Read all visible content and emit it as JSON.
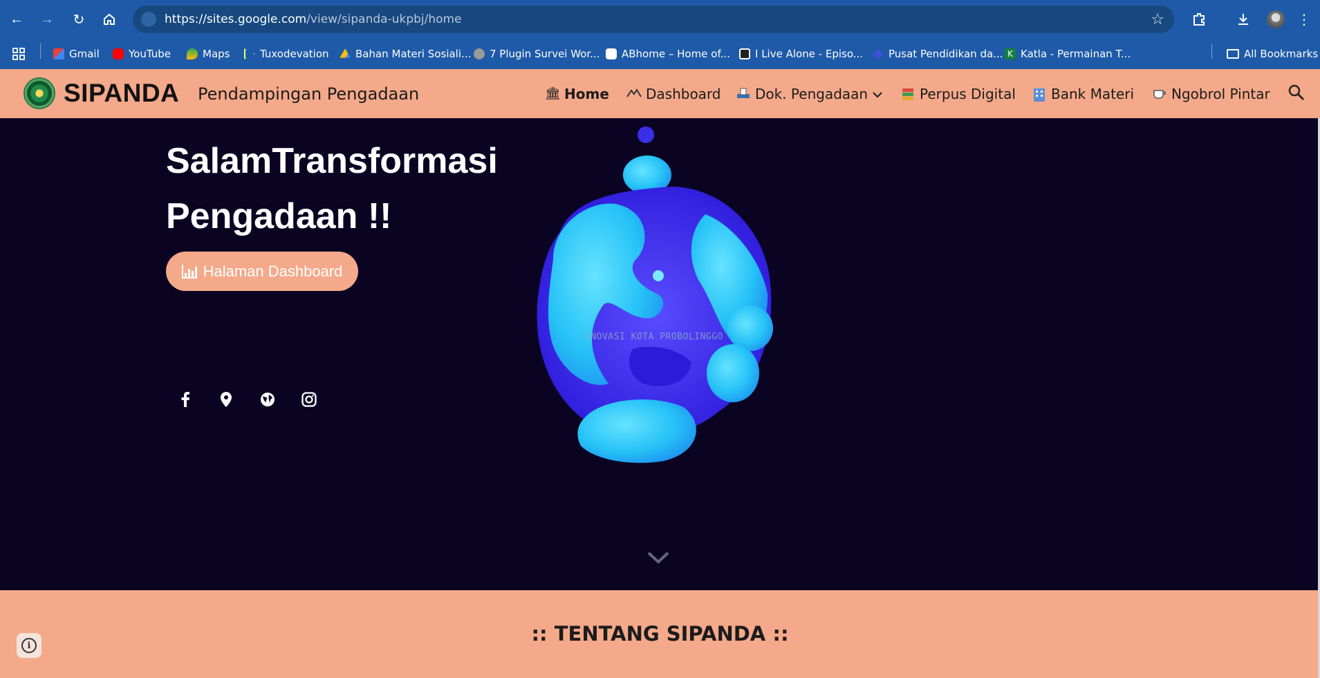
{
  "browser": {
    "url_domain": "https://sites.google.com",
    "url_path": "/view/sipanda-ukpbj/home",
    "nav_icons": [
      "back-icon",
      "forward-icon",
      "reload-icon",
      "home-icon"
    ],
    "right_icons": [
      "extensions-icon",
      "download-icon",
      "profile-avatar",
      "kebab-menu-icon"
    ],
    "colors": {
      "chrome": "#1e5aa8",
      "omnibox": "#17487f"
    }
  },
  "bookmarks": {
    "items": [
      {
        "label": "Gmail",
        "icon": "gmail-icon"
      },
      {
        "label": "YouTube",
        "icon": "youtube-icon"
      },
      {
        "label": "Maps",
        "icon": "maps-icon"
      },
      {
        "label": "Tuxodevation",
        "icon": "play-outline-icon"
      },
      {
        "label": "Bahan Materi Sosiali...",
        "icon": "google-drive-icon"
      },
      {
        "label": "7 Plugin Survei Wor...",
        "icon": "site-icon"
      },
      {
        "label": "ABhome – Home of...",
        "icon": "droplet-icon"
      },
      {
        "label": "I Live Alone - Episo...",
        "icon": "tv-icon"
      },
      {
        "label": "Pusat Pendidikan da...",
        "icon": "site-icon"
      },
      {
        "label": "Katla - Permainan T...",
        "icon": "k-icon"
      }
    ],
    "all_bookmarks": "All Bookmarks"
  },
  "site": {
    "brand": "SIPANDA",
    "tagline": "Pendampingan Pengadaan",
    "menu": [
      {
        "label": "Home",
        "icon": "bank-icon",
        "active": true
      },
      {
        "label": "Dashboard",
        "icon": "mountain-chart-icon"
      },
      {
        "label": "Dok. Pengadaan",
        "icon": "document-tray-icon",
        "has_dropdown": true
      },
      {
        "label": "Perpus Digital",
        "icon": "books-icon"
      },
      {
        "label": "Bank Materi",
        "icon": "building-icon"
      },
      {
        "label": "Ngobrol Pintar",
        "icon": "coffee-cup-icon"
      }
    ],
    "search_icon": "search-icon",
    "colors": {
      "header": "#f4a98a",
      "hero_bg": "#0b0322"
    }
  },
  "hero": {
    "title_line1": "SalamTransformasi",
    "title_line2": "Pengadaan !!",
    "button_label": "Halaman Dashboard",
    "social": [
      "facebook-icon",
      "location-pin-icon",
      "globe-icon",
      "instagram-icon"
    ],
    "watermark": "INOVASI KOTA PROBOLINGGO"
  },
  "section": {
    "title": ":: TENTANG SIPANDA ::"
  }
}
